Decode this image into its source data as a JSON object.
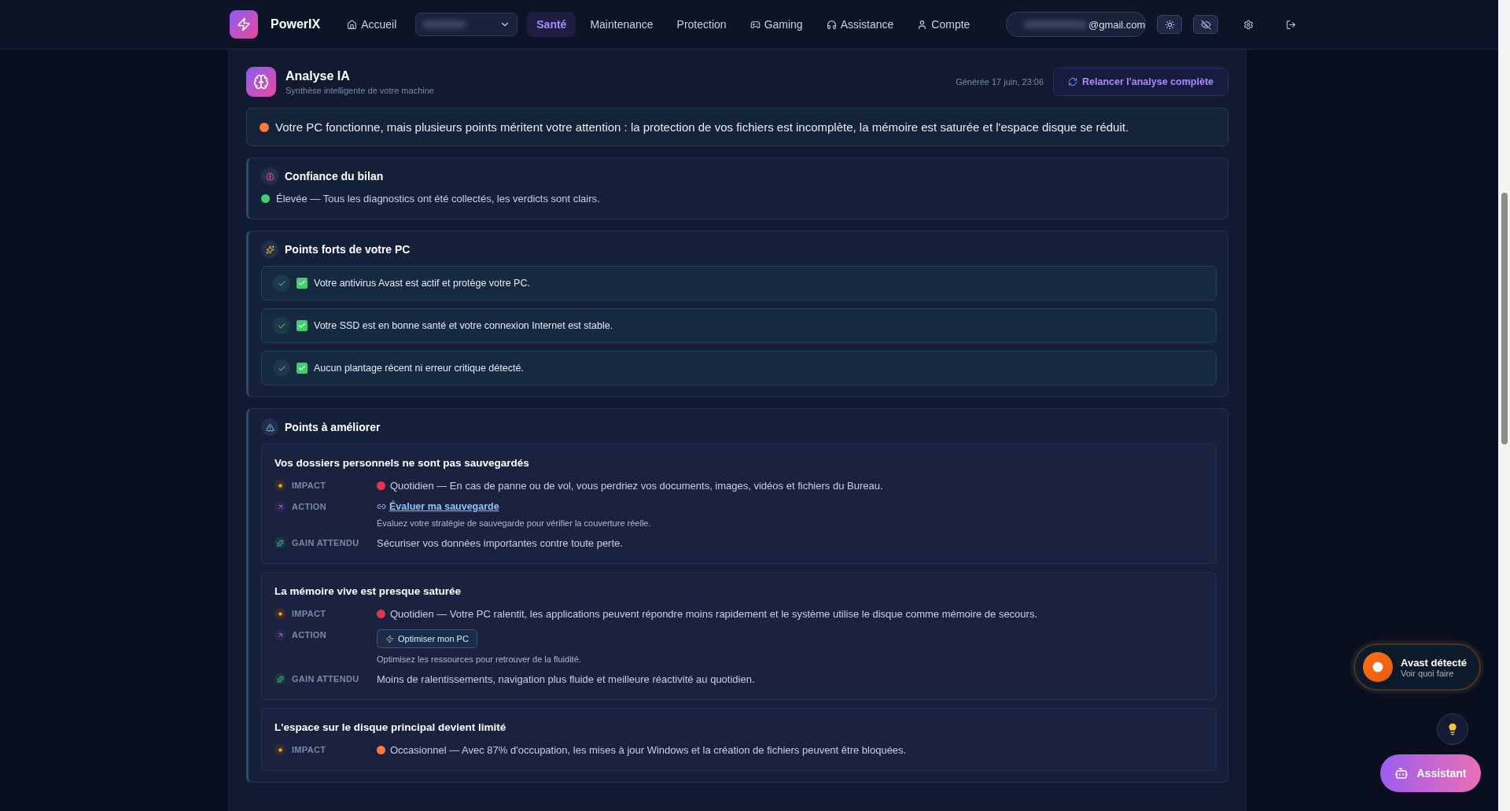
{
  "nav": {
    "brand": "PowerIX",
    "items": [
      {
        "label": "Accueil",
        "kind": "home",
        "selected": false
      },
      {
        "label": "Santé",
        "kind": "plain",
        "selected": true
      },
      {
        "label": "Maintenance",
        "kind": "plain",
        "selected": false
      },
      {
        "label": "Protection",
        "kind": "plain",
        "selected": false
      },
      {
        "label": "Gaming",
        "kind": "gaming",
        "selected": false
      },
      {
        "label": "Assistance",
        "kind": "support",
        "selected": false
      },
      {
        "label": "Compte",
        "kind": "account",
        "selected": false
      }
    ],
    "email": "@gmail.com"
  },
  "analysis": {
    "title": "Analyse IA",
    "subtitle": "Synthèse intelligente de votre machine",
    "generated": "Générée 17 juin, 23:06",
    "rerun_button": "Relancer l'analyse complète"
  },
  "summary": {
    "text": "Votre PC fonctionne, mais plusieurs points méritent votre attention : la protection de vos fichiers est incomplète, la mémoire est saturée et l'espace disque se réduit.",
    "color": "#f97b3d"
  },
  "confidence": {
    "title": "Confiance du bilan",
    "text": "Élevée — Tous les diagnostics ont été collectés, les verdicts sont clairs.",
    "color": "#3ecf6e"
  },
  "strengths": {
    "title": "Points forts de votre PC",
    "items": [
      "Votre antivirus Avast est actif et protège votre PC.",
      "Votre SSD est en bonne santé et votre connexion Internet est stable.",
      "Aucun plantage récent ni erreur critique détecté."
    ]
  },
  "improvements": {
    "title": "Points à améliorer",
    "items": [
      {
        "title": "Vos dossiers personnels ne sont pas sauvegardés",
        "rows": [
          {
            "kind": "impact",
            "label": "IMPACT",
            "color": "#e0384f",
            "text": "Quotidien — En cas de panne ou de vol, vous perdriez vos documents, images, vidéos et fichiers du Bureau."
          },
          {
            "kind": "action",
            "label": "ACTION",
            "action": {
              "kind": "link",
              "label": "Évaluer ma sauvegarde"
            },
            "note": "Évaluez votre stratégie de sauvegarde pour vérifier la couverture réelle."
          },
          {
            "kind": "gain",
            "label": "GAIN ATTENDU",
            "text": "Sécuriser vos données importantes contre toute perte."
          }
        ]
      },
      {
        "title": "La mémoire vive est presque saturée",
        "rows": [
          {
            "kind": "impact",
            "label": "IMPACT",
            "color": "#e0384f",
            "text": "Quotidien — Votre PC ralentit, les applications peuvent répondre moins rapidement et le système utilise le disque comme mémoire de secours."
          },
          {
            "kind": "action",
            "label": "ACTION",
            "action": {
              "kind": "button",
              "label": "Optimiser mon PC"
            },
            "note": "Optimisez les ressources pour retrouver de la fluidité."
          },
          {
            "kind": "gain",
            "label": "GAIN ATTENDU",
            "text": "Moins de ralentissements, navigation plus fluide et meilleure réactivité au quotidien."
          }
        ]
      },
      {
        "title": "L'espace sur le disque principal devient limité",
        "rows": [
          {
            "kind": "impact",
            "label": "IMPACT",
            "color": "#f97b3d",
            "text": "Occasionnel — Avec 87% d'occupation, les mises à jour Windows et la création de fichiers peuvent être bloquées."
          }
        ]
      }
    ]
  },
  "floating": {
    "alert_title": "Avast détecté",
    "alert_subtitle": "Voir quoi faire",
    "assistant": "Assistant"
  }
}
